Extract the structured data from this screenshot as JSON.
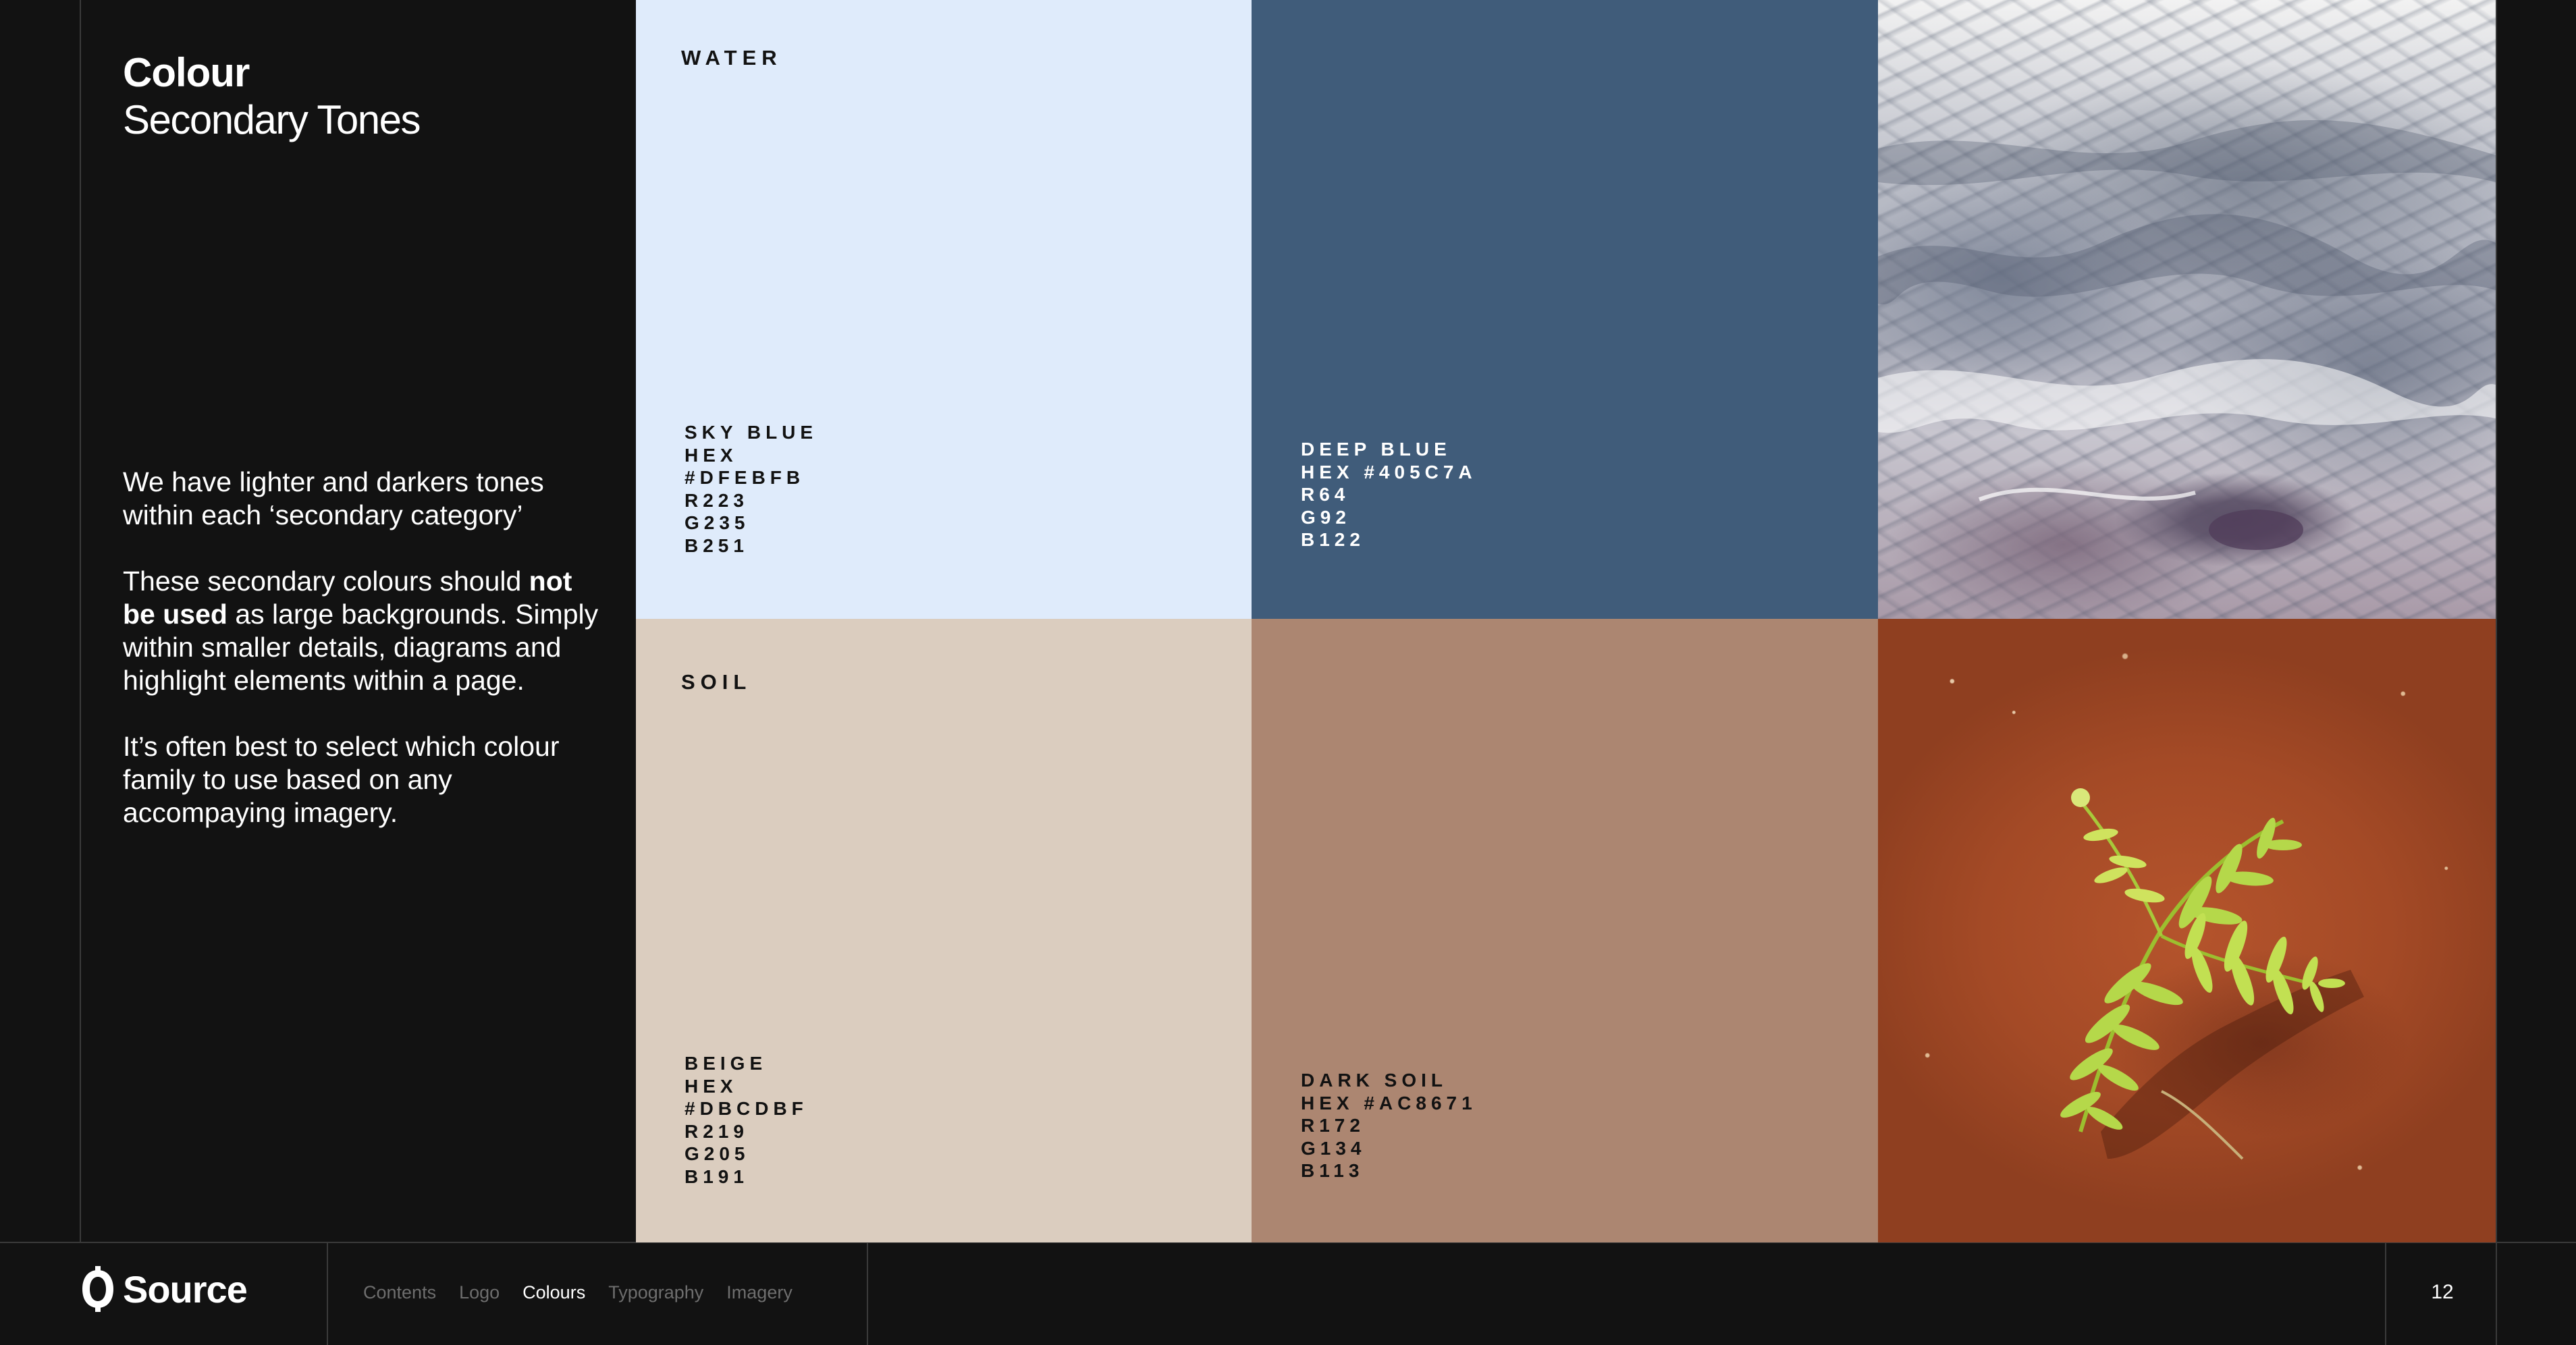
{
  "header": {
    "title": "Colour",
    "subtitle": "Secondary Tones"
  },
  "body": {
    "p1": "We have lighter and darkers tones within each ‘secondary category’",
    "p2_before": "These secondary colours should ",
    "p2_bold": "not be used",
    "p2_after": " as large backgrounds. Simply within smaller details, diagrams and highlight elements within a page.",
    "p3": "It’s often best to select which colour family to use based on any accompaying imagery."
  },
  "swatches": {
    "water": {
      "label": "WATER",
      "light": {
        "color": "#DFEBFB",
        "lines": [
          "SKY BLUE",
          "HEX",
          "#DFEBFB",
          "R223",
          "G235",
          "B251"
        ]
      },
      "dark": {
        "color": "#405C7A",
        "lines": [
          "DEEP BLUE",
          "HEX #405C7A",
          "R64",
          "G92",
          "B122"
        ]
      }
    },
    "soil": {
      "label": "SOIL",
      "light": {
        "color": "#DBCDBF",
        "lines": [
          "BEIGE",
          "HEX",
          "#DBCDBF",
          "R219",
          "G205",
          "B191"
        ]
      },
      "dark": {
        "color": "#AC8671",
        "lines": [
          "DARK SOIL",
          "HEX #AC8671",
          "R172",
          "G134",
          "B113"
        ]
      }
    }
  },
  "images": {
    "water_photo": "aerial-snowy-mountains",
    "soil_photo": "fern-on-red-soil"
  },
  "footer": {
    "brand": "Source",
    "nav": [
      "Contents",
      "Logo",
      "Colours",
      "Typography",
      "Imagery"
    ],
    "active_nav": "Colours",
    "page_number": "12"
  }
}
